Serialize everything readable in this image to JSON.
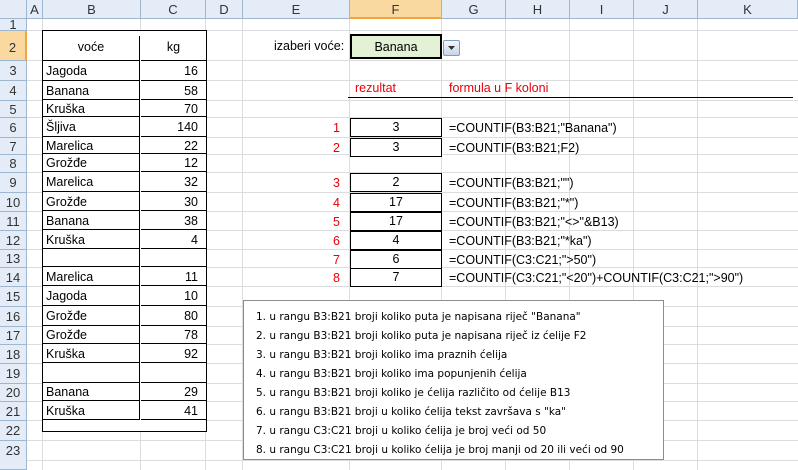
{
  "columns": [
    "A",
    "B",
    "C",
    "D",
    "E",
    "F",
    "G",
    "H",
    "I",
    "J",
    "K"
  ],
  "rows": [
    "1",
    "2",
    "3",
    "4",
    "5",
    "6",
    "7",
    "8",
    "9",
    "10",
    "11",
    "12",
    "13",
    "14",
    "15",
    "16",
    "17",
    "18",
    "19",
    "20",
    "21",
    "22",
    "23"
  ],
  "selected_column": "F",
  "selected_row": "2",
  "fruit_table": {
    "header_name": "voće",
    "header_kg": "kg",
    "rows": [
      {
        "name": "Jagoda",
        "kg": "16"
      },
      {
        "name": "Banana",
        "kg": "58"
      },
      {
        "name": "Kruška",
        "kg": "70"
      },
      {
        "name": "Šljiva",
        "kg": "140"
      },
      {
        "name": "Marelica",
        "kg": "22"
      },
      {
        "name": "Grožđe",
        "kg": "12"
      },
      {
        "name": "Marelica",
        "kg": "32"
      },
      {
        "name": "Grožđe",
        "kg": "30"
      },
      {
        "name": "Banana",
        "kg": "38"
      },
      {
        "name": "Kruška",
        "kg": "4"
      },
      {
        "name": "",
        "kg": ""
      },
      {
        "name": "Marelica",
        "kg": "11"
      },
      {
        "name": "Jagoda",
        "kg": "10"
      },
      {
        "name": "Grožđe",
        "kg": "80"
      },
      {
        "name": "Grožđe",
        "kg": "78"
      },
      {
        "name": "Kruška",
        "kg": "92"
      },
      {
        "name": "",
        "kg": ""
      },
      {
        "name": "Banana",
        "kg": "29"
      },
      {
        "name": "Kruška",
        "kg": "41"
      }
    ]
  },
  "selector": {
    "label": "izaberi voće:",
    "value": "Banana"
  },
  "headers": {
    "result": "rezultat",
    "formula": "formula u F koloni"
  },
  "results": [
    {
      "num": "1",
      "value": "3",
      "formula": "=COUNTIF(B3:B21;\"Banana\")"
    },
    {
      "num": "2",
      "value": "3",
      "formula": "=COUNTIF(B3:B21;F2)"
    },
    {
      "num": "3",
      "value": "2",
      "formula": "=COUNTIF(B3:B21;\"\")"
    },
    {
      "num": "4",
      "value": "17",
      "formula": "=COUNTIF(B3:B21;\"*\")"
    },
    {
      "num": "5",
      "value": "17",
      "formula": "=COUNTIF(B3:B21;\"<>\"&B13)"
    },
    {
      "num": "6",
      "value": "4",
      "formula": "=COUNTIF(B3:B21;\"*ka\")"
    },
    {
      "num": "7",
      "value": "6",
      "formula": "=COUNTIF(C3:C21;\">50\")"
    },
    {
      "num": "8",
      "value": "7",
      "formula": "=COUNTIF(C3:C21;\"<20\")+COUNTIF(C3:C21;\">90\")"
    }
  ],
  "notes": [
    "1. u rangu B3:B21  broji koliko puta je napisana riječ \"Banana\"",
    "2.  u rangu B3:B21  broji koliko puta je napisana riječ  iz ćelije  F2",
    "3.  u rangu B3:B21  broji koliko ima praznih ćelija",
    "4.  u rangu B3:B21  broji koliko ima popunjenih ćelija",
    "5.  u rangu B3:B21  broji koliko je ćelija različito od ćelije B13",
    "6.  u rangu B3:B21  broji u koliko ćelija  tekst završava s  \"ka\"",
    "7.  u rangu C3:C21  broji u koliko ćelija je broj veći od  50",
    "8.  u rangu C3:C21  broji u koliko ćelija je broj manji od  20 ili veći od  90"
  ],
  "icons": {
    "dropdown": "chevron-down-icon"
  }
}
